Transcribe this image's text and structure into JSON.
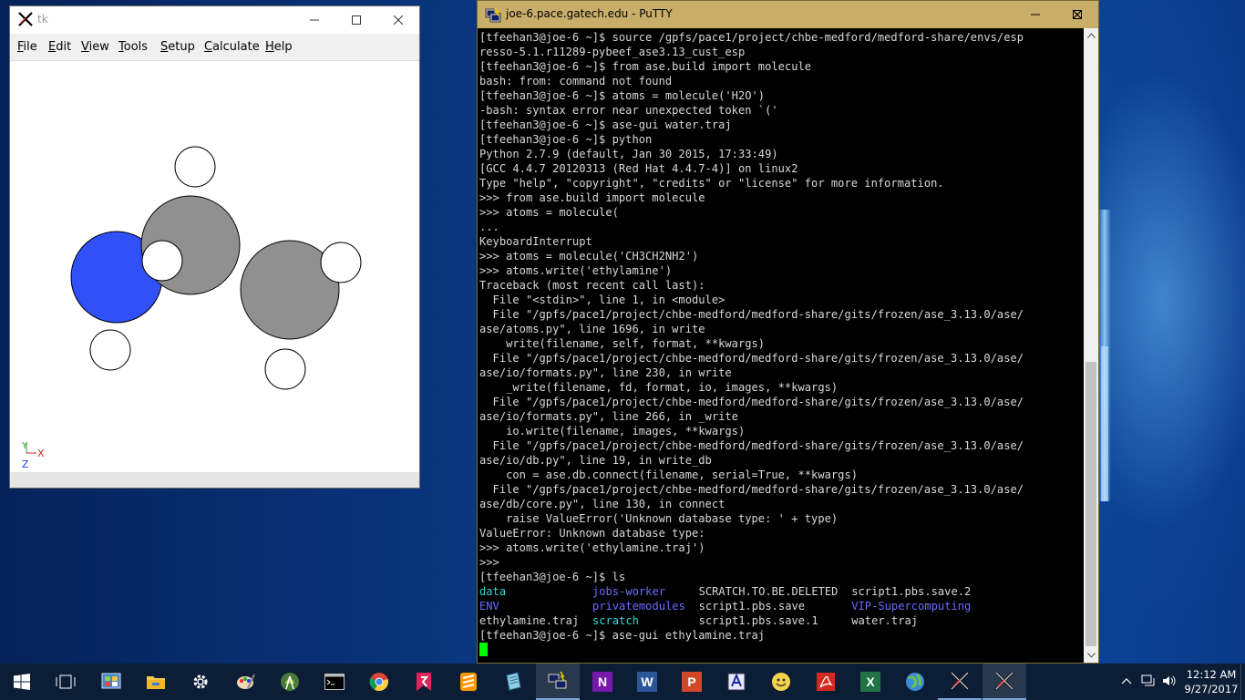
{
  "tk_window": {
    "title": "tk",
    "menu": [
      {
        "label": "File",
        "ul": "F",
        "rest": "ile"
      },
      {
        "label": "Edit",
        "ul": "E",
        "rest": "dit"
      },
      {
        "label": "View",
        "ul": "V",
        "rest": "iew"
      },
      {
        "label": "Tools",
        "ul": "T",
        "rest": "ools"
      },
      {
        "label": "Setup",
        "ul": "S",
        "rest": "etup"
      },
      {
        "label": "Calculate",
        "ul": "C",
        "rest": "alculate"
      },
      {
        "label": "Help",
        "ul": "H",
        "rest": "elp"
      }
    ],
    "axes": {
      "x": "X",
      "y": "Y",
      "z": "Z"
    },
    "atom_colors": {
      "nitrogen": "#3050f8",
      "carbon": "#909090",
      "hydrogen": "#ffffff"
    }
  },
  "putty": {
    "title": "joe-6.pace.gatech.edu - PuTTY",
    "lines": [
      "[tfeehan3@joe-6 ~]$ source /gpfs/pace1/project/chbe-medford/medford-share/envs/esp",
      "resso-5.1.r11289-pybeef_ase3.13_cust_esp",
      "[tfeehan3@joe-6 ~]$ from ase.build import molecule",
      "bash: from: command not found",
      "[tfeehan3@joe-6 ~]$ atoms = molecule('H2O')",
      "-bash: syntax error near unexpected token `('",
      "[tfeehan3@joe-6 ~]$ ase-gui water.traj",
      "[tfeehan3@joe-6 ~]$ python",
      "Python 2.7.9 (default, Jan 30 2015, 17:33:49)",
      "[GCC 4.4.7 20120313 (Red Hat 4.4.7-4)] on linux2",
      "Type \"help\", \"copyright\", \"credits\" or \"license\" for more information.",
      ">>> from ase.build import molecule",
      ">>> atoms = molecule(",
      "...",
      "KeyboardInterrupt",
      ">>> atoms = molecule('CH3CH2NH2')",
      ">>> atoms.write('ethylamine')",
      "Traceback (most recent call last):",
      "  File \"<stdin>\", line 1, in <module>",
      "  File \"/gpfs/pace1/project/chbe-medford/medford-share/gits/frozen/ase_3.13.0/ase/",
      "ase/atoms.py\", line 1696, in write",
      "    write(filename, self, format, **kwargs)",
      "  File \"/gpfs/pace1/project/chbe-medford/medford-share/gits/frozen/ase_3.13.0/ase/",
      "ase/io/formats.py\", line 230, in write",
      "    _write(filename, fd, format, io, images, **kwargs)",
      "  File \"/gpfs/pace1/project/chbe-medford/medford-share/gits/frozen/ase_3.13.0/ase/",
      "ase/io/formats.py\", line 266, in _write",
      "    io.write(filename, images, **kwargs)",
      "  File \"/gpfs/pace1/project/chbe-medford/medford-share/gits/frozen/ase_3.13.0/ase/",
      "ase/io/db.py\", line 19, in write_db",
      "    con = ase.db.connect(filename, serial=True, **kwargs)",
      "  File \"/gpfs/pace1/project/chbe-medford/medford-share/gits/frozen/ase_3.13.0/ase/",
      "ase/db/core.py\", line 130, in connect",
      "    raise ValueError('Unknown database type: ' + type)",
      "ValueError: Unknown database type:",
      ">>> atoms.write('ethylamine.traj')",
      ">>>",
      "[tfeehan3@joe-6 ~]$ ls"
    ],
    "ls_output": [
      [
        {
          "t": "data",
          "c": "cyan"
        },
        {
          "t": "jobs-worker",
          "c": "blue"
        },
        {
          "t": "SCRATCH.TO.BE.DELETED",
          "c": ""
        },
        {
          "t": "script1.pbs.save.2",
          "c": ""
        }
      ],
      [
        {
          "t": "ENV",
          "c": "blue"
        },
        {
          "t": "privatemodules",
          "c": "blue"
        },
        {
          "t": "script1.pbs.save",
          "c": ""
        },
        {
          "t": "VIP-Supercomputing",
          "c": "blue"
        }
      ],
      [
        {
          "t": "ethylamine.traj",
          "c": ""
        },
        {
          "t": "scratch",
          "c": "cyan"
        },
        {
          "t": "script1.pbs.save.1",
          "c": ""
        },
        {
          "t": "water.traj",
          "c": ""
        }
      ]
    ],
    "last_command": "[tfeehan3@joe-6 ~]$ ase-gui ethylamine.traj"
  },
  "taskbar": {
    "clock_time": "12:12 AM",
    "clock_date": "9/27/2017",
    "icons": [
      "windows-start-icon",
      "task-view-icon",
      "control-panel-icon",
      "file-explorer-icon",
      "settings-icon",
      "paint-icon",
      "android-studio-icon",
      "command-prompt-icon",
      "chrome-icon",
      "cygwin-icon",
      "sublime-text-icon",
      "notepad-icon",
      "putty-icon",
      "onenote-icon",
      "word-icon",
      "powerpoint-icon",
      "paint-tool-icon",
      "smiley-icon",
      "acrobat-icon",
      "excel-icon",
      "globe-icon",
      "xming-icon",
      "xming-icon"
    ],
    "word_letter": "W",
    "onenote_letter": "N",
    "excel_letter": "X",
    "ppt_letter": "P"
  }
}
